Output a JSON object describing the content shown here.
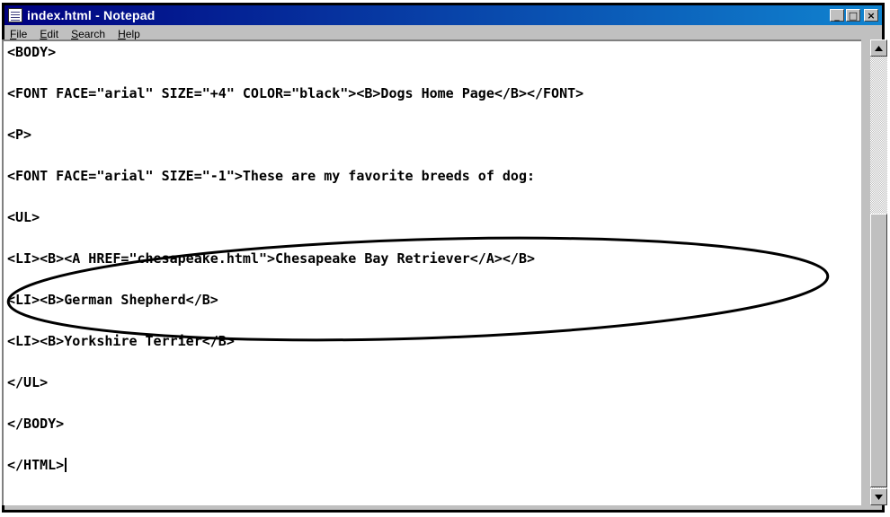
{
  "window": {
    "title": "index.html - Notepad",
    "controls": [
      "_",
      "□",
      "×"
    ]
  },
  "menu": [
    {
      "label": "File",
      "underline": "F",
      "rest": "ile"
    },
    {
      "label": "Edit",
      "underline": "E",
      "rest": "dit"
    },
    {
      "label": "Search",
      "underline": "S",
      "rest": "earch"
    },
    {
      "label": "Help",
      "underline": "H",
      "rest": "elp"
    }
  ],
  "editor": {
    "lines": [
      "<BODY>",
      "<FONT FACE=\"arial\" SIZE=\"+4\" COLOR=\"black\"><B>Dogs Home Page</B></FONT>",
      "<P>",
      "<FONT FACE=\"arial\" SIZE=\"-1\">These are my favorite breeds of dog:",
      "<UL>",
      "<LI><B><A HREF=\"chesapeake.html\">Chesapeake Bay Retriever</A></B>",
      "<LI><B>German Shepherd</B>",
      "<LI><B>Yorkshire Terrier</B>",
      "</UL>",
      "</BODY>",
      "</HTML>"
    ]
  },
  "scrollbar": {
    "up_icon": "scroll-up-arrow",
    "down_icon": "scroll-down-arrow"
  },
  "colors": {
    "titlebar_start": "#000080",
    "titlebar_end": "#1084d0",
    "chrome": "#c0c0c0"
  }
}
